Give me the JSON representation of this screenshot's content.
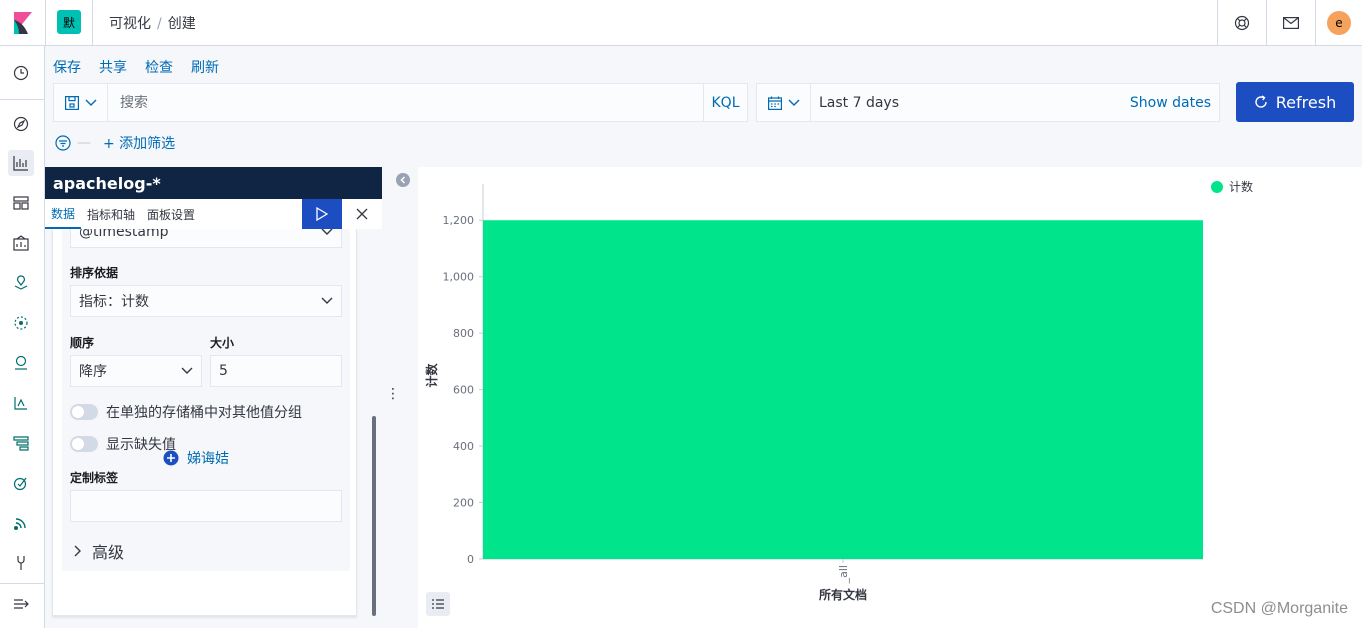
{
  "header": {
    "space_initial": "默",
    "breadcrumbs": [
      "可视化",
      "创建"
    ],
    "user_initial": "e"
  },
  "top_menu": [
    "保存",
    "共享",
    "检查",
    "刷新"
  ],
  "query": {
    "placeholder": "搜索",
    "language": "KQL"
  },
  "date_picker": {
    "value": "Last 7 days",
    "show_dates": "Show dates"
  },
  "refresh_label": "Refresh",
  "filter": {
    "add_label": "+ 添加筛选"
  },
  "editor": {
    "index_pattern": "apachelog-*",
    "tabs": [
      "数据",
      "指标和轴",
      "面板设置"
    ],
    "field_value": "@timestamp",
    "order_by_label": "排序依据",
    "order_by_value": "指标：计数",
    "order_label": "顺序",
    "order_value": "降序",
    "size_label": "大小",
    "size_value": "5",
    "group_other_label": "在单独的存储桶中对其他值分组",
    "show_missing_label": "显示缺失值",
    "custom_label_label": "定制标签",
    "custom_label_value": "",
    "advanced_label": "高级",
    "add_label": "娣诲姞"
  },
  "chart_data": {
    "type": "bar",
    "categories": [
      "_all"
    ],
    "series": [
      {
        "name": "计数",
        "values": [
          1200
        ]
      }
    ],
    "xlabel": "所有文档",
    "ylabel": "计数",
    "ylim": [
      0,
      1300
    ],
    "yticks": [
      0,
      200,
      400,
      600,
      800,
      1000,
      1200
    ],
    "ytick_labels": [
      "0",
      "200",
      "400",
      "600",
      "800",
      "1,000",
      "1,200"
    ],
    "legend": "top-right",
    "color": "#00e58c"
  },
  "watermark": "CSDN @Morganite"
}
